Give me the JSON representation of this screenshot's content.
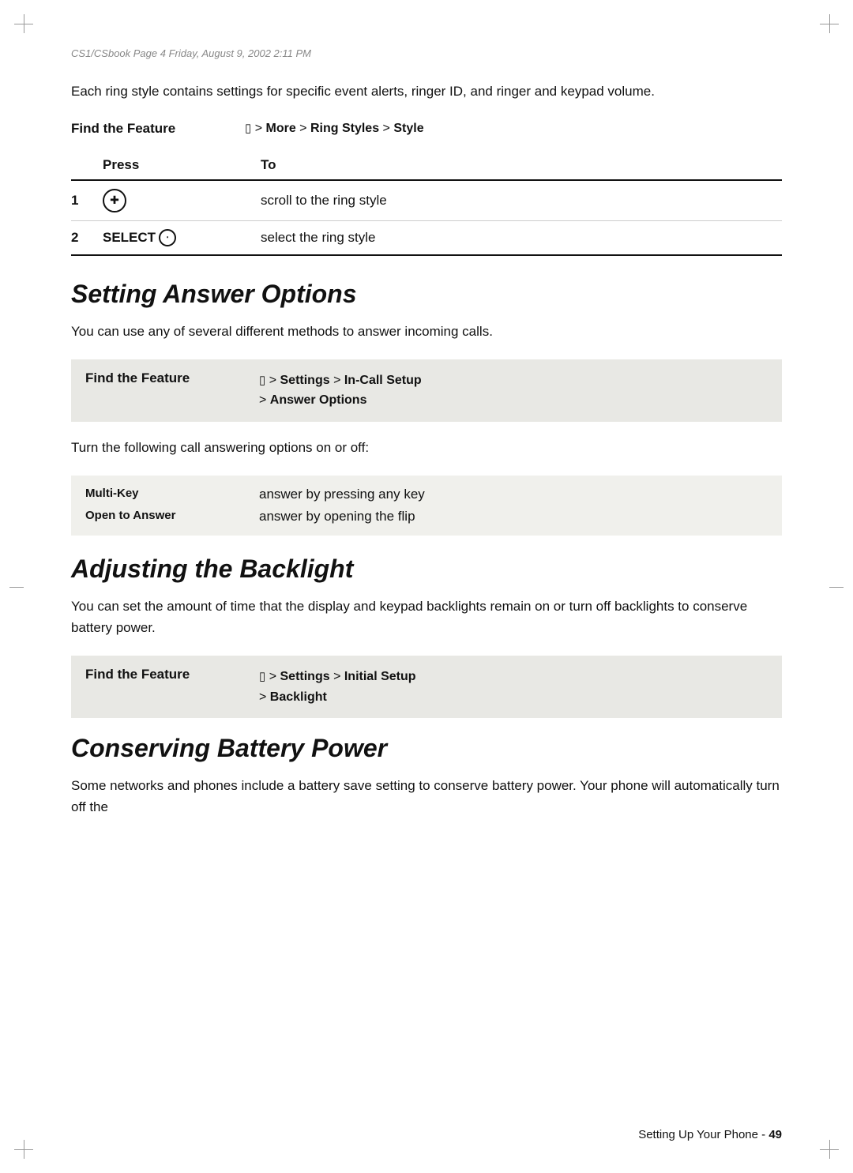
{
  "header": {
    "line": "CS1/CSbook Page 4 Friday, August 9, 2002 2:11 PM"
  },
  "intro": {
    "text": "Each ring style contains settings for specific event alerts, ringer ID, and ringer and keypad volume."
  },
  "ring_styles": {
    "find_feature_label": "Find the Feature",
    "find_feature_path": "M > More > Ring Styles > Style",
    "table": {
      "col_press": "Press",
      "col_to": "To",
      "rows": [
        {
          "num": "1",
          "press_icon": "nav_circle",
          "to": "scroll to the ring style"
        },
        {
          "num": "2",
          "press_label": "SELECT",
          "press_icon": "small_circle",
          "to": "select the ring style"
        }
      ]
    }
  },
  "answer_options": {
    "title": "Setting Answer Options",
    "body": "You can use any of several different methods to answer incoming calls.",
    "find_feature_label": "Find the Feature",
    "find_feature_path_line1": "M > Settings > In-Call Setup",
    "find_feature_path_line2": "> Answer Options",
    "turn_text": "Turn the following call answering options on or off:",
    "options": [
      {
        "name": "Multi-Key",
        "description": "answer by pressing any key"
      },
      {
        "name": "Open to Answer",
        "description": "answer by opening the flip"
      }
    ]
  },
  "backlight": {
    "title": "Adjusting the Backlight",
    "body": "You can set the amount of time that the display and keypad backlights remain on or turn off backlights to conserve battery power.",
    "find_feature_label": "Find the Feature",
    "find_feature_path_line1": "M > Settings > Initial Setup",
    "find_feature_path_line2": "> Backlight"
  },
  "battery": {
    "title": "Conserving Battery Power",
    "body": "Some networks and phones include a battery save setting to conserve battery power. Your phone will automatically turn off the"
  },
  "footer": {
    "text": "Setting Up Your Phone - ",
    "page_num": "49"
  }
}
